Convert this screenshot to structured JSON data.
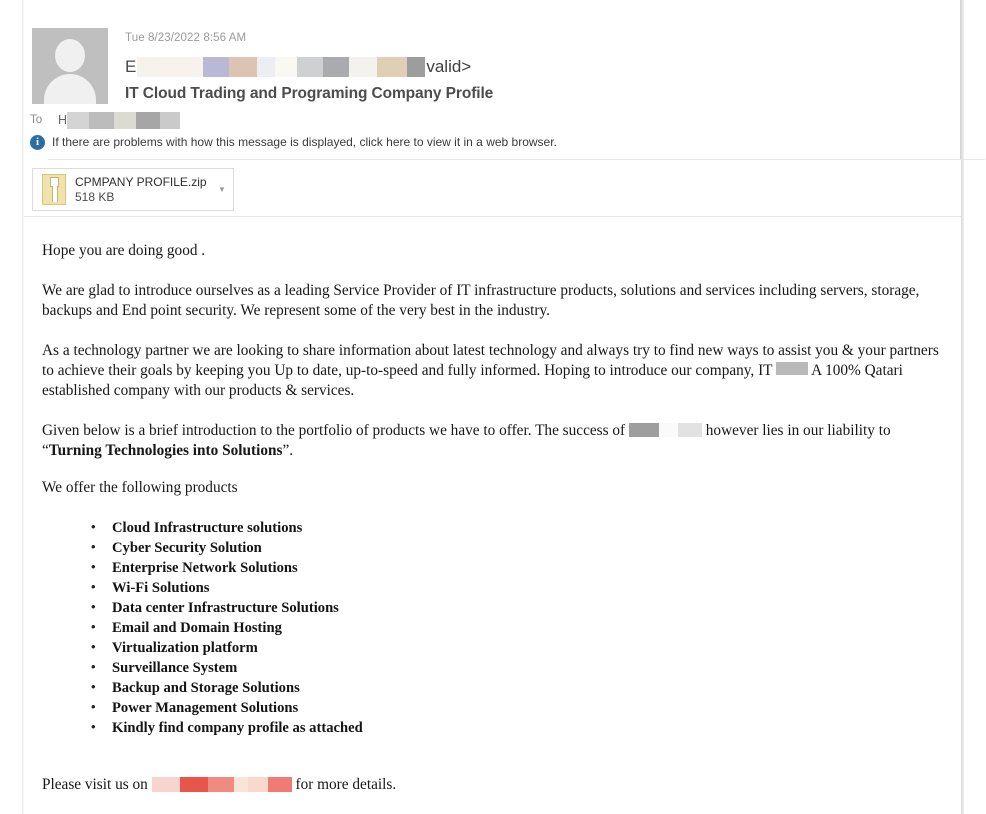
{
  "header": {
    "avatar_alt": "default contact photo",
    "datetime": "Tue 8/23/2022 8:56 AM",
    "sender_lead_char": "E",
    "sender_tail": "valid>",
    "subject": "IT Cloud Trading and Programing Company Profile",
    "to_label": "To",
    "to_lead_char": "H",
    "info_icon_glyph": "i",
    "info_bar_text": "If there are problems with how this message is displayed, click here to view it in a web browser."
  },
  "attachment": {
    "file_name": "CPMPANY PROFILE.zip",
    "file_size": "518 KB",
    "caret_glyph": "▼"
  },
  "body": {
    "greeting": "Hope you are doing good .",
    "paragraph_intro": "We are glad to introduce ourselves as a leading Service Provider of IT infrastructure products, solutions and services including servers, storage, backups and End point security. We represent some of the very best in the industry.",
    "paragraph_partner_part1": "As a technology  partner we are looking to share information about latest technology and always try to find new ways to assist you & your partners to achieve their goals by keeping you Up to date, up-to-speed and fully informed. Hoping to introduce our  company, IT",
    "paragraph_partner_part2": "A 100% Qatari established  company with our products & services.",
    "paragraph_portfolio_part1": "Given below is a brief introduction to the portfolio of products we have to offer. The success of",
    "paragraph_portfolio_part2": "however lies in our liability",
    "paragraph_portfolio_part3": "to “",
    "paragraph_portfolio_quote": "Turning Technologies into Solutions",
    "paragraph_portfolio_part4": "”.",
    "products_intro": "We offer the following products",
    "products": [
      "Cloud Infrastructure solutions",
      "Cyber Security Solution",
      "Enterprise Network Solutions",
      "Wi-Fi Solutions",
      "Data center Infrastructure Solutions",
      "Email and Domain Hosting",
      "Virtualization platform",
      "Surveillance System",
      "Backup and Storage Solutions",
      "Power Management Solutions",
      "Kindly find company profile  as attached"
    ],
    "closing_part1": "Please visit us on",
    "closing_part2": "for more details."
  },
  "colors": {
    "info_icon_blue": "#2e6da4",
    "subject_gray": "#4c4c4c",
    "meta_gray": "#9a9a9a",
    "zip_icon_yellow": "#efe2ad",
    "redaction_url_red": "#e8554a",
    "page_background": "#ffffff"
  }
}
